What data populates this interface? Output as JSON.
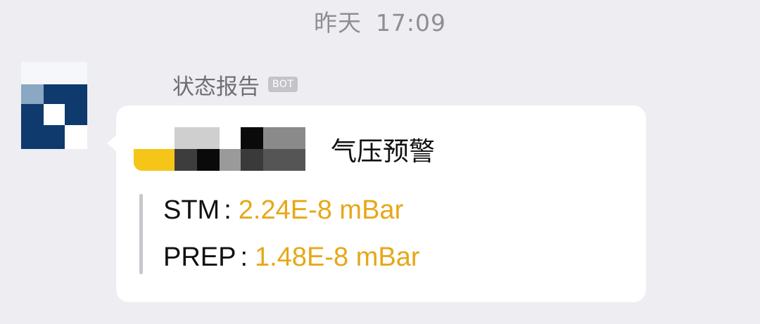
{
  "timestamp": {
    "day": "昨天",
    "time": "17:09"
  },
  "sender": {
    "name": "状态报告",
    "badge": "BOT"
  },
  "message": {
    "title": "气压预警",
    "readings": [
      {
        "label": "STM",
        "value": "2.24E-8 mBar"
      },
      {
        "label": "PREP",
        "value": "1.48E-8 mBar"
      }
    ]
  },
  "colors": {
    "background": "#ededf2",
    "card": "#ffffff",
    "value_accent": "#e6a817",
    "avatar_primary": "#0e3a6e"
  }
}
